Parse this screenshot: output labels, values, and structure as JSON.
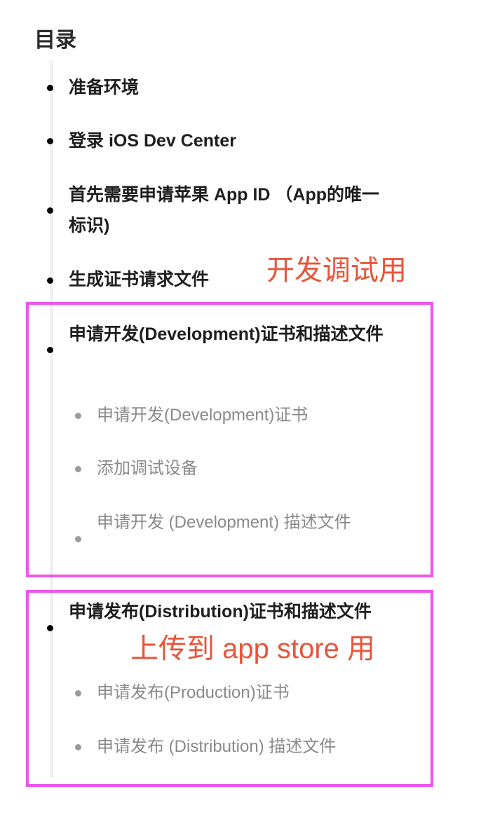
{
  "toc": {
    "title": "目录",
    "items": [
      {
        "label": "准备环境"
      },
      {
        "label": "登录 iOS Dev Center"
      },
      {
        "label": "首先需要申请苹果 App ID （App的唯一标识)"
      },
      {
        "label": "生成证书请求文件"
      },
      {
        "label": "申请开发(Development)证书和描述文件",
        "children": [
          {
            "label": "申请开发(Development)证书"
          },
          {
            "label": "添加调试设备"
          },
          {
            "label": "申请开发 (Development) 描述文件"
          }
        ]
      },
      {
        "label": "申请发布(Distribution)证书和描述文件",
        "children": [
          {
            "label": "申请发布(Production)证书"
          },
          {
            "label": "申请发布 (Distribution) 描述文件"
          }
        ]
      }
    ]
  },
  "annotations": {
    "development": "开发调试用",
    "distribution": "上传到 app store 用"
  },
  "colors": {
    "frame": "#ee55ee",
    "annotation": "#e8553a",
    "subitem_text": "#8a8a8a"
  }
}
